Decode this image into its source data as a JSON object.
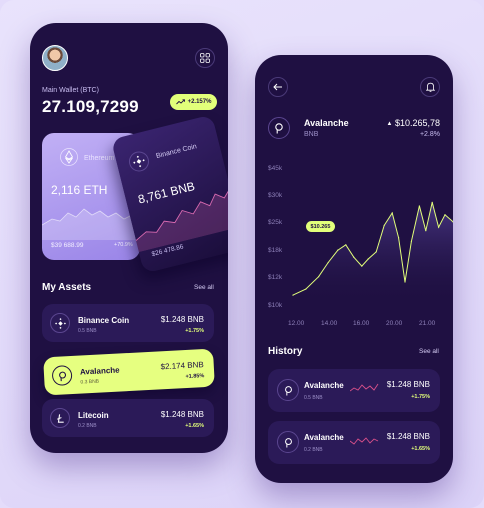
{
  "wallet": {
    "label": "Main Wallet (BTC)",
    "value": "27.109,7299",
    "change": "+2.157%"
  },
  "cards": {
    "eth": {
      "name": "Ethereum",
      "amount": "2,116 ETH",
      "usd": "$39 688.99",
      "pct": "+70.9%"
    },
    "bnb": {
      "name": "Binance Coin",
      "amount": "8,761 BNB",
      "usd": "$26 478.86"
    }
  },
  "my_assets": {
    "title": "My Assets",
    "see_all": "See all",
    "items": [
      {
        "name": "Binance Coin",
        "sub": "0.5 BNB",
        "value": "$1.248 BNB",
        "pct": "+1.75%"
      },
      {
        "name": "Avalanche",
        "sub": "0.3 BNB",
        "value": "$2.174 BNB",
        "pct": "+1.85%"
      },
      {
        "name": "Litecoin",
        "sub": "0.2 BNB",
        "value": "$1.248 BNB",
        "pct": "+1.65%"
      }
    ]
  },
  "detail": {
    "coin_name": "Avalanche",
    "coin_sub": "BNB",
    "price": "$10.265,78",
    "pct": "+2.8%",
    "tooltip": "$10.265"
  },
  "chart_data": {
    "type": "line",
    "x": [
      "12.00",
      "14.00",
      "16.00",
      "20.00",
      "21.00"
    ],
    "ylabels": [
      "$45k",
      "$30k",
      "$25k",
      "$18k",
      "$12k",
      "$10k"
    ],
    "line_points": [
      [
        0.0,
        10.8
      ],
      [
        0.08,
        12.5
      ],
      [
        0.16,
        16.0
      ],
      [
        0.22,
        20.0
      ],
      [
        0.28,
        23.5
      ],
      [
        0.33,
        25.0
      ],
      [
        0.38,
        21.5
      ],
      [
        0.43,
        19.0
      ],
      [
        0.47,
        21.0
      ],
      [
        0.52,
        23.0
      ],
      [
        0.57,
        30.5
      ],
      [
        0.62,
        34.0
      ],
      [
        0.66,
        27.0
      ],
      [
        0.7,
        14.5
      ],
      [
        0.74,
        26.0
      ],
      [
        0.79,
        36.0
      ],
      [
        0.83,
        29.0
      ],
      [
        0.87,
        37.0
      ],
      [
        0.91,
        30.0
      ],
      [
        0.95,
        33.5
      ],
      [
        1.0,
        31.5
      ]
    ],
    "y_tick_values": [
      45,
      30,
      25,
      18,
      12,
      10
    ],
    "ylim": [
      8,
      47
    ]
  },
  "history": {
    "title": "History",
    "see_all": "See all",
    "items": [
      {
        "name": "Avalanche",
        "sub": "0.5 BNB",
        "value": "$1.248 BNB",
        "pct": "+1.75%"
      },
      {
        "name": "Avalanche",
        "sub": "0.2 BNB",
        "value": "$1.248 BNB",
        "pct": "+1.65%"
      }
    ]
  },
  "colors": {
    "accent": "#e2ff7a",
    "phone_bg": "#1f1042",
    "card_bg": "#2b1a58",
    "eth_card": "#b3a0f2"
  }
}
